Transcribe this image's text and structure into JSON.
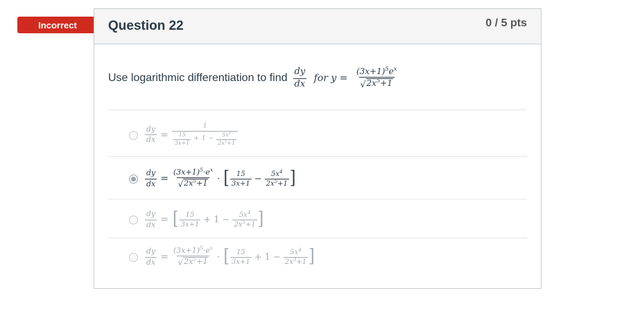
{
  "status_badge": "Incorrect",
  "question": {
    "title": "Question 22",
    "points": "0 / 5 pts"
  },
  "prompt": {
    "text": "Use logarithmic differentiation to find",
    "dy": "dy",
    "dx": "dx",
    "for_y": "for y =",
    "numerator": "(3x+1)",
    "num_exp": "5",
    "num_tail": "e",
    "num_tail_exp": "x",
    "den_radicand": "2x",
    "den_exp": "5",
    "den_tail": "+1"
  },
  "answers": [
    {
      "selected": false,
      "label": "dy/dx = 1 / (15/(3x+1) + 1 − 5x⁴/(2x⁵+1))"
    },
    {
      "selected": true,
      "label": "dy/dx = (3x+1)⁵·eˣ / √(2x⁵+1) · [15/(3x+1) − 5x⁴/(2x⁵+1)]"
    },
    {
      "selected": false,
      "label": "dy/dx = [15/(3x+1) + 1 − 5x⁴/(2x⁵+1)]"
    },
    {
      "selected": false,
      "label": "dy/dx = (3x+1)⁵·eˣ / √(2x⁵+1) · [15/(3x+1) + 1 − 5x⁴/(2x³+1)]"
    }
  ],
  "symbols": {
    "dy": "dy",
    "dx": "dx",
    "eq": "=",
    "one": "1",
    "fifteen": "15",
    "three_x_plus_1": "3x+1",
    "plus": "+",
    "minus": "−",
    "cdot": "·",
    "five_x": "5x",
    "four": "4",
    "five": "5",
    "three": "3",
    "two_x": "2x",
    "plus_one": "+1",
    "three_x_1": "(3x+1)",
    "e": "e",
    "x": "x",
    "lbr": "[",
    "rbr": "]"
  },
  "colors": {
    "badge": "#d12b1f",
    "header_bg": "#f5f5f5",
    "border": "#c7cdd1",
    "text": "#2d3b45",
    "faded": "#a4abb0"
  }
}
